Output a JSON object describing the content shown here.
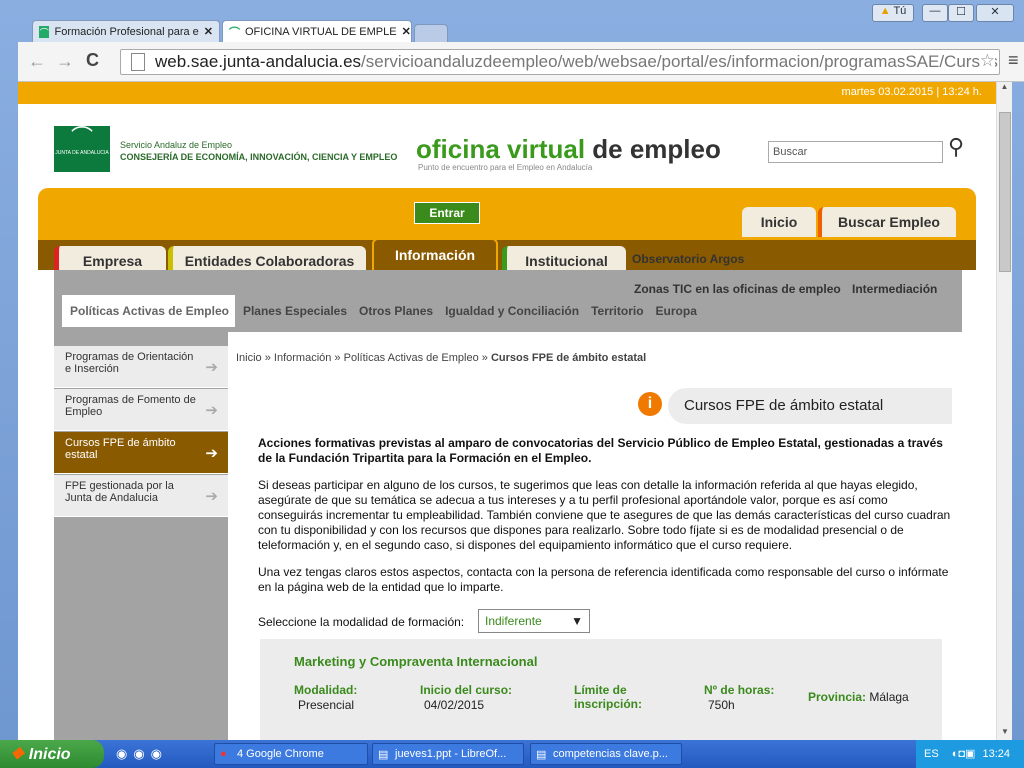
{
  "browser": {
    "tabs": [
      {
        "label": "Formación Profesional para e"
      },
      {
        "label": "OFICINA VIRTUAL DE EMPLE"
      }
    ],
    "url_host": "web.sae.junta-andalucia.es",
    "url_path": "/servicioandaluzdeempleo/web/websae/portal/es/informacion/programasSAE/CursosFPE",
    "user_badge": "Tú"
  },
  "site": {
    "date": "martes 03.02.2015 | 13:24 h.",
    "org_line1": "Servicio Andaluz de Empleo",
    "org_line2": "CONSEJERÍA DE ECONOMÍA, INNOVACIÓN, CIENCIA Y EMPLEO",
    "logo_small": "JUNTA DE ANDALUCIA",
    "brand_a": "oficina virtual",
    "brand_b": "de empleo",
    "tagline": "Punto de encuentro para el Empleo en Andalucía",
    "search_placeholder": "Buscar",
    "enter": "Entrar",
    "inicio": "Inicio",
    "buscar_empleo": "Buscar Empleo"
  },
  "nav": {
    "empresa": "Empresa",
    "entidades": "Entidades Colaboradoras",
    "informacion": "Información",
    "institucional": "Institucional",
    "observatorio": "Observatorio Argos",
    "zonas": "Zonas TIC en las oficinas de empleo",
    "intermediacion": "Intermediación"
  },
  "subnav": [
    "Políticas Activas de Empleo",
    "Planes Especiales",
    "Otros Planes",
    "Igualdad y Conciliación",
    "Territorio",
    "Europa"
  ],
  "sidebar": [
    "Programas de Orientación e Inserción",
    "Programas de Fomento de Empleo",
    "Cursos FPE de ámbito estatal",
    "FPE gestionada por la Junta de Andalucia"
  ],
  "breadcrumb": {
    "prefix": "Inicio » Información » Políticas Activas de Empleo » ",
    "current": "Cursos FPE de ámbito estatal"
  },
  "content": {
    "title": "Cursos FPE de ámbito estatal",
    "intro": "Acciones formativas previstas al amparo de convocatorias del Servicio Público de Empleo Estatal, gestionadas a través de la Fundación Tripartita para la Formación en el Empleo.",
    "p1": "Si deseas participar en alguno de los cursos, te sugerimos que leas con detalle la información referida al que hayas elegido, asegúrate de que su temática se adecua a tus intereses y a tu perfil profesional aportándole valor, porque es así como conseguirás incrementar tu empleabilidad. También conviene que te asegures de que las demás características del curso cuadran con tu disponibilidad y con los recursos que dispones para realizarlo. Sobre todo fíjate si es de modalidad presencial o de teleformación y, en el segundo caso, si dispones del equipamiento informático que el curso requiere.",
    "p2": "Una vez tengas claros estos aspectos, contacta con la persona de referencia identificada como responsable del curso o infórmate en la página web de la entidad que lo imparte.",
    "select_label": "Seleccione la modalidad de formación:",
    "select_value": "Indiferente"
  },
  "course": {
    "title": "Marketing y Compraventa Internacional",
    "mod_label": "Modalidad:",
    "mod_value": "Presencial",
    "start_label": "Inicio del curso:",
    "start_value": "04/02/2015",
    "limit_label": "Límite de inscripción:",
    "hours_label": "Nº de horas:",
    "hours_value": "750h",
    "prov_label": "Provincia:",
    "prov_value": "Málaga"
  },
  "taskbar": {
    "start": "Inicio",
    "items": [
      "4 Google Chrome",
      "jueves1.ppt - LibreOf...",
      "competencias clave.p..."
    ],
    "lang": "ES",
    "clock": "13:24"
  },
  "colors": {
    "orange": "#f0a800",
    "brown": "#8a5a00",
    "green": "#3a8a1c",
    "gray": "#a3a3a3"
  }
}
